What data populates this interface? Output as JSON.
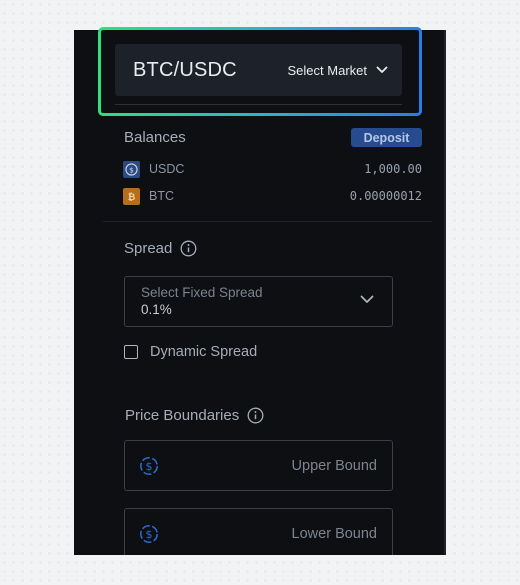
{
  "market": {
    "pair": "BTC/USDC",
    "select_label": "Select Market"
  },
  "balances": {
    "title": "Balances",
    "deposit_label": "Deposit",
    "items": [
      {
        "symbol": "USDC",
        "amount": "1,000.00",
        "icon": "usdc-coin-icon"
      },
      {
        "symbol": "BTC",
        "amount": "0.00000012",
        "icon": "bitcoin-icon"
      }
    ]
  },
  "spread": {
    "title": "Spread",
    "select_label": "Select Fixed Spread",
    "selected_value": "0.1%",
    "dynamic_label": "Dynamic Spread",
    "dynamic_checked": false
  },
  "price_boundaries": {
    "title": "Price Boundaries",
    "upper_placeholder": "Upper Bound",
    "lower_placeholder": "Lower Bound"
  },
  "colors": {
    "panel_bg": "#0d0f13",
    "accent_blue": "#264b8f",
    "highlight_gradient_start": "#2ee07f",
    "highlight_gradient_end": "#2a7de8",
    "dollar_icon": "#2f6bd1"
  }
}
